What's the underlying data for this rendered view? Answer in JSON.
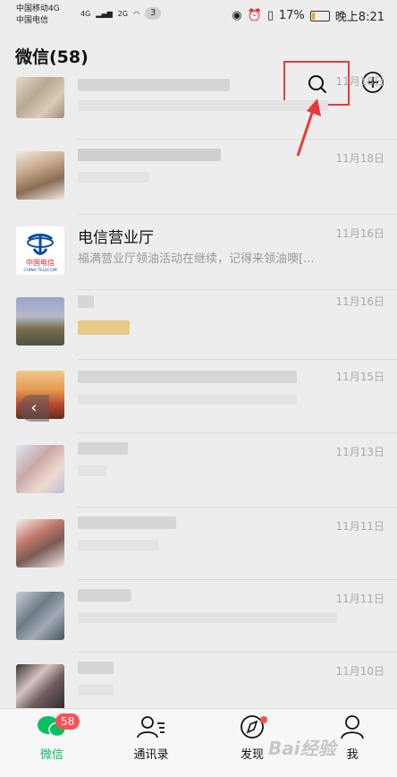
{
  "status": {
    "carrier1": "中国移动4G",
    "carrier2": "中国电信",
    "net1": "4G",
    "net2": "2G",
    "badge": "3",
    "battery": "17%",
    "battery_fraction": 0.17,
    "time": "晚上8:21"
  },
  "header": {
    "title": "微信(58)"
  },
  "chats": [
    {
      "name": "",
      "preview": "",
      "date": "11月18日"
    },
    {
      "name": "",
      "preview": "",
      "date": "11月18日"
    },
    {
      "name": "电信营业厅",
      "preview": "福满营业厅领油活动在继续，记得来领油噢[...",
      "date": "11月16日"
    },
    {
      "name": "",
      "preview": "",
      "date": "11月16日"
    },
    {
      "name": "",
      "preview": "",
      "date": "11月15日"
    },
    {
      "name": "",
      "preview": "",
      "date": "11月13日"
    },
    {
      "name": "",
      "preview": "",
      "date": "11月11日"
    },
    {
      "name": "",
      "preview": "",
      "date": "11月11日"
    },
    {
      "name": "",
      "preview": "",
      "date": "11月10日"
    }
  ],
  "telecom_logo": {
    "cn": "中国电信",
    "en": "CHINA TELECOM"
  },
  "tabs": [
    {
      "label": "微信",
      "badge": "58"
    },
    {
      "label": "通讯录"
    },
    {
      "label": "发现"
    },
    {
      "label": "我"
    }
  ],
  "colors": {
    "accent": "#07c160",
    "badge": "#fa5151",
    "highlight": "#e83a3a"
  },
  "watermark": "Bai经验"
}
